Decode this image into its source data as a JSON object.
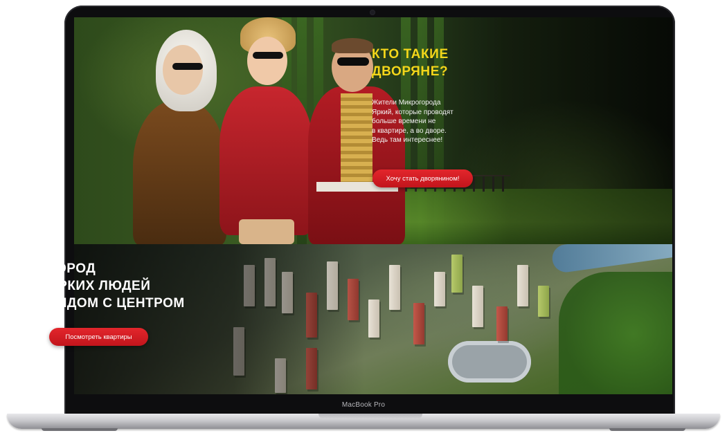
{
  "device": {
    "model_label": "MacBook Pro"
  },
  "hero_top": {
    "headline_line1": "КТО ТАКИЕ",
    "headline_line2": "ДВОРЯНЕ?",
    "lead_lines": [
      "Жители Микрогорода",
      "Яркий, которые проводят",
      "больше времени не",
      "в квартире, а во дворе.",
      "Ведь там интереснее!"
    ],
    "cta_label": "Хочу стать дворянином!"
  },
  "hero_bottom": {
    "headline_lines": [
      "ГОРОД",
      "ЯРКИХ ЛЮДЕЙ",
      "РЯДОМ С ЦЕНТРОМ"
    ],
    "cta_label": "Посмотреть квартиры"
  },
  "colors": {
    "accent_yellow": "#f4d61a",
    "accent_red": "#d81f26",
    "bezel": "#0d0d0f"
  }
}
